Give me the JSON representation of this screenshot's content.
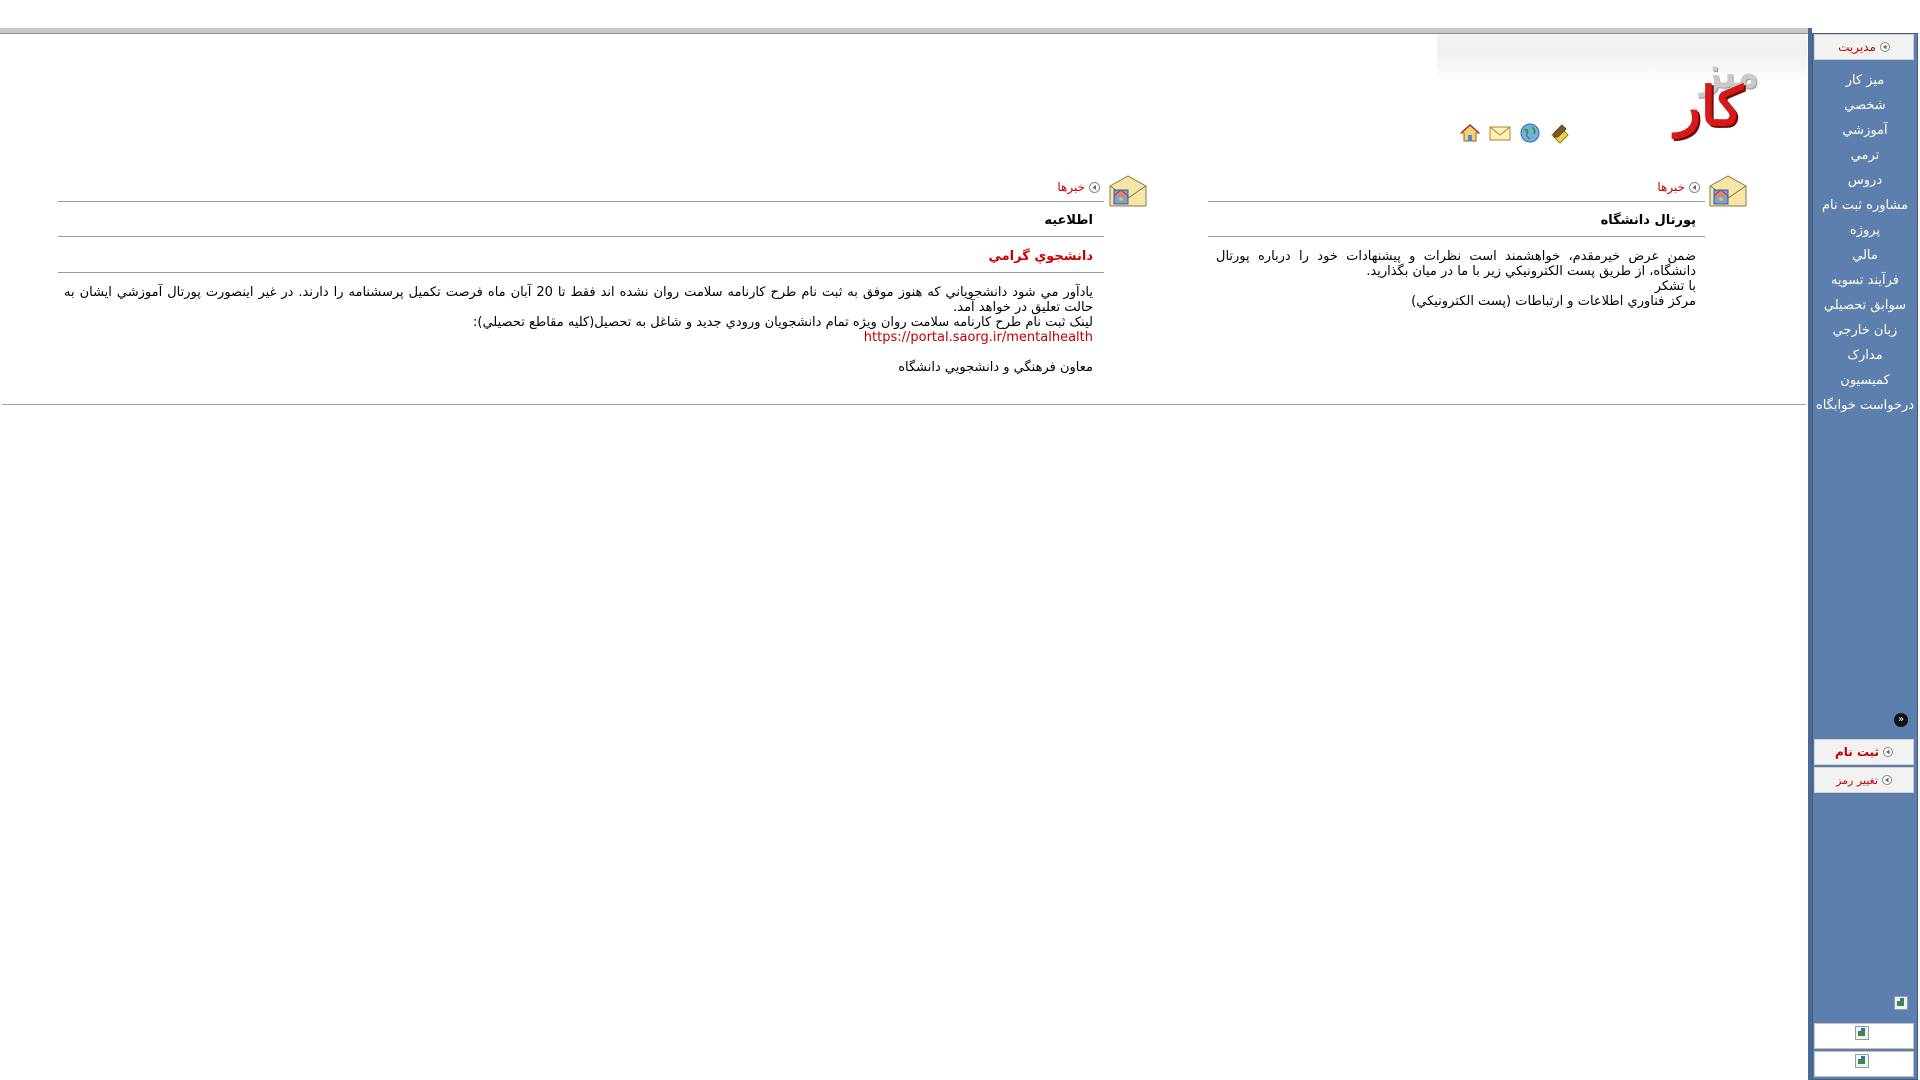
{
  "sidebar": {
    "header_label": "مدیریت",
    "items": [
      {
        "label": "ميز کار"
      },
      {
        "label": "شخصي"
      },
      {
        "label": "آموزشي"
      },
      {
        "label": "ترمي"
      },
      {
        "label": "دروس"
      },
      {
        "label": "مشاوره ثبت نام"
      },
      {
        "label": "پروژه"
      },
      {
        "label": "مالي"
      },
      {
        "label": "فرآيند تسويه"
      },
      {
        "label": "سوابق تحصيلي"
      },
      {
        "label": "زبان خارجي"
      },
      {
        "label": "مدارک"
      },
      {
        "label": "کميسيون"
      },
      {
        "label": "درخواست خوابگاه"
      }
    ],
    "registration_label": "ثبت نام",
    "change_password_label": "تغيير رمز",
    "accent": "#5c7fad"
  },
  "logo": {
    "line1": "ميز",
    "line2": "كار"
  },
  "toolbar": {
    "icons": [
      "home-icon",
      "mail-icon",
      "globe-icon",
      "edit-icon"
    ]
  },
  "panel_right": {
    "title": "خبرها",
    "heading": "پورتال دانشگاه",
    "body_lines": [
      "ضمن عرض خيرمقدم، خواهشمند است نظرات و پيشنهادات خود را درباره پورتال دانشگاه، از طريق پست الکترونيکي زير با ما در ميان بگذاريد.",
      "با تشکر",
      "مرکز فناوري اطلاعات و ارتباطات (پست الکترونيکي)"
    ]
  },
  "panel_left": {
    "title": "خبرها",
    "heading": "اطلاعيه",
    "subheading": "دانشجوي گرامي",
    "body_lines": [
      "يادآور مي شود دانشجوياني که هنوز موفق به ثبت نام طرح کارنامه سلامت روان نشده اند فقط تا 20 آبان ماه فرصت تکميل پرسشنامه را دارند. در غير اينصورت پورتال آموزشي ايشان به حالت تعليق در خواهد آمد.",
      "لينک ثبت نام طرح کارنامه سلامت روان ويژه تمام دانشجويان ورودي جديد و شاغل به تحصيل(کليه مقاطع تحصيلي):"
    ],
    "link": "https://portal.saorg.ir/mentalhealth",
    "signature": "معاون فرهنگي و دانشجويي دانشگاه"
  }
}
